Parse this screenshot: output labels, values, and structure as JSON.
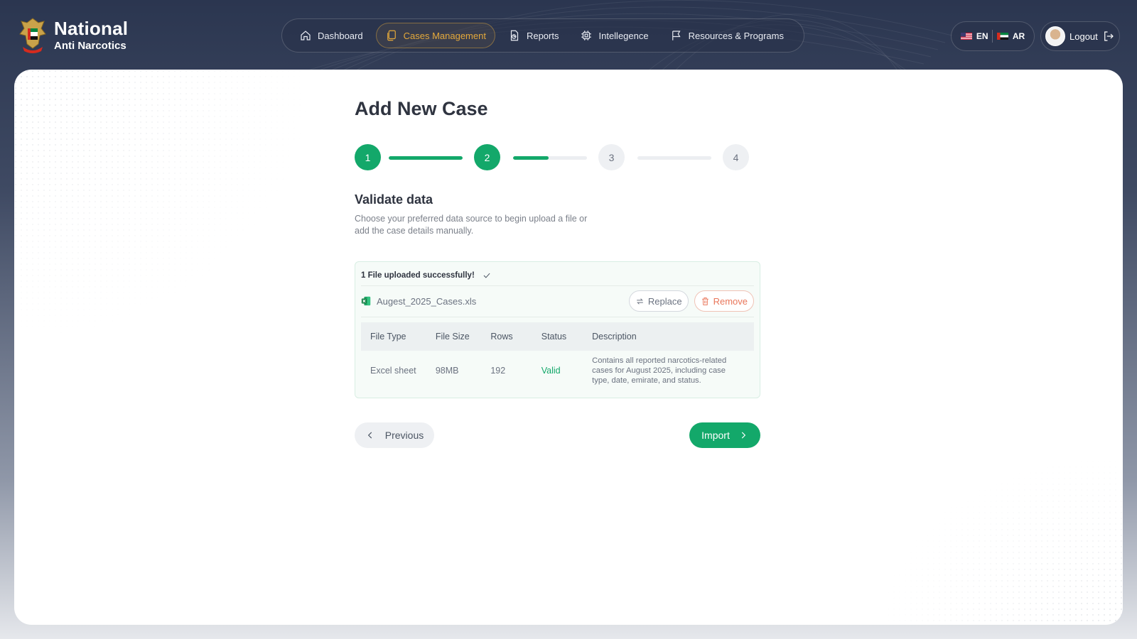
{
  "brand": {
    "title": "National",
    "subtitle": "Anti Narcotics"
  },
  "nav": {
    "items": [
      {
        "label": "Dashboard",
        "icon": "home-icon",
        "active": false
      },
      {
        "label": "Cases Management",
        "icon": "files-icon",
        "active": true
      },
      {
        "label": "Reports",
        "icon": "report-icon",
        "active": false
      },
      {
        "label": "Intellegence",
        "icon": "chip-icon",
        "active": false
      },
      {
        "label": "Resources & Programs",
        "icon": "flag-icon",
        "active": false
      }
    ],
    "active_color": "#e3a83b"
  },
  "language": {
    "en": "EN",
    "ar": "AR"
  },
  "user": {
    "logout_label": "Logout"
  },
  "page": {
    "title": "Add New Case"
  },
  "stepper": {
    "steps": [
      "1",
      "2",
      "3",
      "4"
    ],
    "current_step": 2,
    "progress": [
      1.0,
      0.48,
      0.0
    ],
    "accent": "#13a86a"
  },
  "section": {
    "title": "Validate data",
    "description": "Choose your preferred data source to begin  upload a file or add the case details manually."
  },
  "upload": {
    "status_text": "1 File uploaded successfully!",
    "file_name": "Augest_2025_Cases.xls",
    "replace_label": "Replace",
    "remove_label": "Remove",
    "table": {
      "headers": [
        "File Type",
        "File Size",
        "Rows",
        "Status",
        "Description"
      ],
      "row": {
        "file_type": "Excel sheet",
        "file_size": "98MB",
        "rows": "192",
        "status": "Valid",
        "description": "Contains all reported narcotics-related cases for August 2025, including case type, date, emirate, and status."
      }
    }
  },
  "actions": {
    "previous_label": "Previous",
    "import_label": "Import"
  }
}
